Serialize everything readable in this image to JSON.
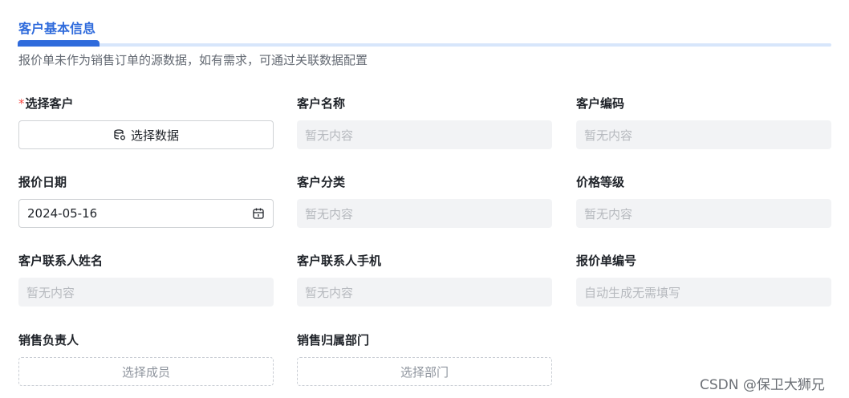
{
  "tab": {
    "title": "客户基本信息"
  },
  "hint": "报价单未作为销售订单的源数据，如有需求，可通过关联数据配置",
  "fields": {
    "select_customer": {
      "required_mark": "*",
      "label": "选择客户",
      "button_label": "选择数据",
      "icon": "database-icon"
    },
    "customer_name": {
      "label": "客户名称",
      "placeholder": "暂无内容"
    },
    "customer_code": {
      "label": "客户编码",
      "placeholder": "暂无内容"
    },
    "quote_date": {
      "label": "报价日期",
      "value": "2024-05-16",
      "icon": "calendar-icon"
    },
    "customer_category": {
      "label": "客户分类",
      "placeholder": "暂无内容"
    },
    "price_level": {
      "label": "价格等级",
      "placeholder": "暂无内容"
    },
    "contact_name": {
      "label": "客户联系人姓名",
      "placeholder": "暂无内容"
    },
    "contact_phone": {
      "label": "客户联系人手机",
      "placeholder": "暂无内容"
    },
    "quote_number": {
      "label": "报价单编号",
      "placeholder": "自动生成无需填写"
    },
    "sales_owner": {
      "label": "销售负责人",
      "button_label": "选择成员"
    },
    "sales_department": {
      "label": "销售归属部门",
      "button_label": "选择部门"
    }
  },
  "watermark": "CSDN @保卫大狮兄",
  "colors": {
    "accent": "#2f6bdc",
    "required": "#f54a45",
    "disabled_bg": "#f2f3f5"
  }
}
